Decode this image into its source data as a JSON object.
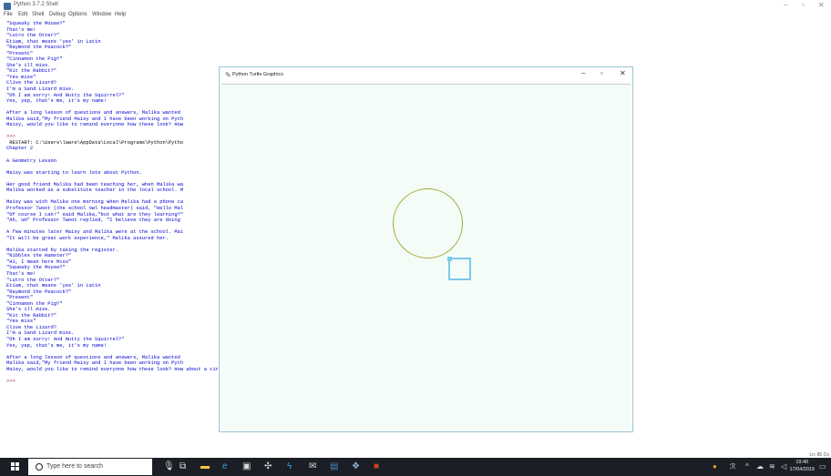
{
  "shell": {
    "title": "Python 3.7.2 Shell",
    "menus": [
      "File",
      "Edit",
      "Shell",
      "Debug",
      "Options",
      "Window",
      "Help"
    ],
    "lines": [
      {
        "text": "\"Squeaky the Mouse?\"",
        "kind": "output"
      },
      {
        "text": "That's me!",
        "kind": "output"
      },
      {
        "text": "\"Lutro the Otter?\"",
        "kind": "output"
      },
      {
        "text": "Etiam, that means 'yes' in Latin",
        "kind": "output"
      },
      {
        "text": "\"Raymond the Peacock?\"",
        "kind": "output"
      },
      {
        "text": "\"Present\"",
        "kind": "output"
      },
      {
        "text": "\"Cinnamon the Pig?\"",
        "kind": "output"
      },
      {
        "text": "She's ill miss.",
        "kind": "output"
      },
      {
        "text": "\"Kit the Rabbit?\"",
        "kind": "output"
      },
      {
        "text": "\"Yes miss\"",
        "kind": "output"
      },
      {
        "text": "Clive the Lizard?",
        "kind": "output"
      },
      {
        "text": "I'm a Sand Lizard miss.",
        "kind": "output"
      },
      {
        "text": "\"Oh I am sorry! And Nutty the Squirrel?\"",
        "kind": "output"
      },
      {
        "text": "Yes, yep, that's me, it's my name!",
        "kind": "output"
      },
      {
        "text": "",
        "kind": "blank"
      },
      {
        "text": "After a long lesson of questions and answers, Malika wanted",
        "kind": "output"
      },
      {
        "text": "Malika said,\"My friend Maisy and I have been working on Pyth",
        "kind": "output"
      },
      {
        "text": "Maisy, would you like to remind everyone how these look? How",
        "kind": "output"
      },
      {
        "text": "",
        "kind": "blank"
      },
      {
        "text": ">>>",
        "kind": "prompt"
      },
      {
        "text": " RESTART: C:\\Users\\lawre\\AppData\\Local\\Programs\\Python\\Pytho",
        "kind": "restart"
      },
      {
        "text": "Chapter 2",
        "kind": "output"
      },
      {
        "text": "",
        "kind": "blank"
      },
      {
        "text": "A Geometry Lesson",
        "kind": "output"
      },
      {
        "text": "",
        "kind": "blank"
      },
      {
        "text": "Maisy was starting to learn lots about Python.",
        "kind": "output"
      },
      {
        "text": "",
        "kind": "blank"
      },
      {
        "text": "Her good friend Malika had been teaching her, when Malika wa",
        "kind": "output"
      },
      {
        "text": "Malika worked as a substitute teacher in the local school. M",
        "kind": "output"
      },
      {
        "text": "",
        "kind": "blank"
      },
      {
        "text": "Maisy was with Malika one morning when Malika had a phone ca",
        "kind": "output"
      },
      {
        "text": "Professor Twoot (the school owl headmaster) said, \"Hello Mal",
        "kind": "output"
      },
      {
        "text": "\"Of course I can!\" said Malika,\"but what are they learning?\"",
        "kind": "output"
      },
      {
        "text": "\"Ah, um\" Professor Twoot replied, \"I believe they are doing",
        "kind": "output"
      },
      {
        "text": "",
        "kind": "blank"
      },
      {
        "text": "A few minutes later Maisy and Malika were at the school. Mai",
        "kind": "output"
      },
      {
        "text": "\"It will be great work experience,\" Malika assured her.",
        "kind": "output"
      },
      {
        "text": "",
        "kind": "blank"
      },
      {
        "text": "Malika started by taking the register.",
        "kind": "output"
      },
      {
        "text": "\"Nibbles the Hamster?\"",
        "kind": "output"
      },
      {
        "text": "\"Hi, I mean here Miss\"",
        "kind": "output"
      },
      {
        "text": "\"Squeaky the Mouse?\"",
        "kind": "output"
      },
      {
        "text": "That's me!",
        "kind": "output"
      },
      {
        "text": "\"Lutro the Otter?\"",
        "kind": "output"
      },
      {
        "text": "Etiam, that means 'yes' in Latin",
        "kind": "output"
      },
      {
        "text": "\"Raymond the Peacock?\"",
        "kind": "output"
      },
      {
        "text": "\"Present\"",
        "kind": "output"
      },
      {
        "text": "\"Cinnamon the Pig?\"",
        "kind": "output"
      },
      {
        "text": "She's ill miss.",
        "kind": "output"
      },
      {
        "text": "\"Kit the Rabbit?\"",
        "kind": "output"
      },
      {
        "text": "\"Yes miss\"",
        "kind": "output"
      },
      {
        "text": "Clive the Lizard?",
        "kind": "output"
      },
      {
        "text": "I'm a Sand Lizard miss.",
        "kind": "output"
      },
      {
        "text": "\"Oh I am sorry! And Nutty the Squirrel?\"",
        "kind": "output"
      },
      {
        "text": "Yes, yep, that's me, it's my name!",
        "kind": "output"
      },
      {
        "text": "",
        "kind": "blank"
      },
      {
        "text": "After a long lesson of questions and answers, Malika wanted",
        "kind": "output"
      },
      {
        "text": "Malika said,\"My friend Maisy and I have been working on Pyth",
        "kind": "output"
      },
      {
        "text": "Maisy, would you like to remind everyone how these look? How about a circle and a square?\"",
        "kind": "output"
      },
      {
        "text": "",
        "kind": "blank"
      },
      {
        "text": ">>>",
        "kind": "prompt"
      }
    ],
    "status": "Ln: 85  Co"
  },
  "turtle": {
    "title": "Python Turtle Graphics",
    "colors": {
      "canvas": "#f4fcf8",
      "circle": "#a8a830",
      "square": "#7ec8e8"
    }
  },
  "taskbar": {
    "search_placeholder": "Type here to search",
    "time": "19:40",
    "date": "17/04/2019"
  }
}
